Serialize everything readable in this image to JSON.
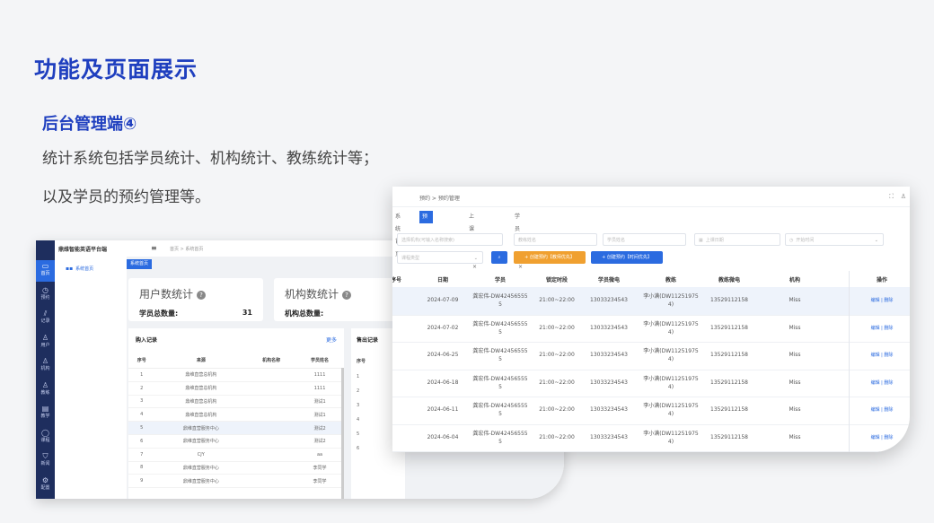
{
  "slide": {
    "title": "功能及页面展示",
    "section": "后台管理端④",
    "desc_line1": "统计系统包括学员统计、机构统计、教练统计等；",
    "desc_line2": "以及学员的预约管理等。"
  },
  "back_window": {
    "brand": "鼎维智能英语平台端",
    "breadcrumb": "首页  >  系统首页",
    "nav_home": "系统首页",
    "page_tab": "系统首页",
    "sidebar": [
      {
        "icon": "monitor-icon",
        "glyph": "▭",
        "label": "首页"
      },
      {
        "icon": "clock-icon",
        "glyph": "◷",
        "label": "预约"
      },
      {
        "icon": "chart-icon",
        "glyph": "⫽",
        "label": "记录"
      },
      {
        "icon": "user-icon",
        "glyph": "♙",
        "label": "用户"
      },
      {
        "icon": "org-icon",
        "glyph": "♙",
        "label": "机构"
      },
      {
        "icon": "coach-icon",
        "glyph": "♙",
        "label": "教练"
      },
      {
        "icon": "doc-icon",
        "glyph": "▤",
        "label": "教学"
      },
      {
        "icon": "course-icon",
        "glyph": "◯",
        "label": "课程"
      },
      {
        "icon": "shield-icon",
        "glyph": "⛉",
        "label": "新闻"
      },
      {
        "icon": "gear-icon",
        "glyph": "⚙",
        "label": "配置"
      }
    ],
    "user_stats": {
      "title": "用户数统计",
      "label": "学员总数量:",
      "value": "31"
    },
    "org_stats": {
      "title": "机构数统计",
      "label": "机构总数量:"
    },
    "purchase": {
      "title": "购入记录",
      "more": "更多",
      "columns": [
        "序号",
        "来源",
        "机构名称",
        "学员姓名"
      ],
      "rows": [
        [
          "1",
          "鼎维直营总机构",
          "",
          "1111"
        ],
        [
          "2",
          "鼎维直营总机构",
          "",
          "1111"
        ],
        [
          "3",
          "鼎维直营总机构",
          "",
          "测试1"
        ],
        [
          "4",
          "鼎维直营总机构",
          "",
          "测试1"
        ],
        [
          "5",
          "鼎维直营服务中心",
          "",
          "测试2"
        ],
        [
          "6",
          "鼎维直营服务中心",
          "",
          "测试2"
        ],
        [
          "7",
          "CJY",
          "",
          "aa"
        ],
        [
          "8",
          "鼎维直营服务中心",
          "",
          "李同学"
        ],
        [
          "9",
          "鼎维直营服务中心",
          "",
          "李同学"
        ]
      ]
    },
    "sales": {
      "title": "售出记录",
      "column": "序号",
      "rows": [
        "1",
        "2",
        "3",
        "4",
        "5",
        "6"
      ]
    }
  },
  "front_window": {
    "breadcrumb": "预约  >  预约管理",
    "tabs": [
      "系统首页",
      "预约管理",
      "上课记录",
      "学员管理"
    ],
    "filters": {
      "org": "选择机构(可输入名称搜索)",
      "coach_name": "教练姓名",
      "student_name": "学员姓名",
      "date": "上课日期",
      "time": "开始时间",
      "course_type": "课程类型"
    },
    "buttons": {
      "search": "⌕",
      "create_teacher": "+  创建预约【教师优先】",
      "create_time": "+  创建预约【时间优先】"
    },
    "columns": [
      "序号",
      "日期",
      "学员",
      "锁定时段",
      "学员微电",
      "教练",
      "教练微电",
      "机构",
      "操作"
    ],
    "rows": [
      {
        "date": "2024-07-09",
        "student": [
          "龚宏伟-DW42456555",
          "5"
        ],
        "slot": "21:00~22:00",
        "phone": "13033234543",
        "coach": [
          "李小满(DW11251975",
          "4)"
        ],
        "coach_phone": "13529112158",
        "org": "Miss",
        "ops": "编辑 | 删除"
      },
      {
        "date": "2024-07-02",
        "student": [
          "龚宏伟-DW42456555",
          "5"
        ],
        "slot": "21:00~22:00",
        "phone": "13033234543",
        "coach": [
          "李小满(DW11251975",
          "4)"
        ],
        "coach_phone": "13529112158",
        "org": "Miss",
        "ops": "编辑 | 删除"
      },
      {
        "date": "2024-06-25",
        "student": [
          "龚宏伟-DW42456555",
          "5"
        ],
        "slot": "21:00~22:00",
        "phone": "13033234543",
        "coach": [
          "李小满(DW11251975",
          "4)"
        ],
        "coach_phone": "13529112158",
        "org": "Miss",
        "ops": "编辑 | 删除"
      },
      {
        "date": "2024-06-18",
        "student": [
          "龚宏伟-DW42456555",
          "5"
        ],
        "slot": "21:00~22:00",
        "phone": "13033234543",
        "coach": [
          "李小满(DW11251975",
          "4)"
        ],
        "coach_phone": "13529112158",
        "org": "Miss",
        "ops": "编辑 | 删除"
      },
      {
        "date": "2024-06-11",
        "student": [
          "龚宏伟-DW42456555",
          "5"
        ],
        "slot": "21:00~22:00",
        "phone": "13033234543",
        "coach": [
          "李小满(DW11251975",
          "4)"
        ],
        "coach_phone": "13529112158",
        "org": "Miss",
        "ops": "编辑 | 删除"
      },
      {
        "date": "2024-06-04",
        "student": [
          "龚宏伟-DW42456555",
          "5"
        ],
        "slot": "21:00~22:00",
        "phone": "13033234543",
        "coach": [
          "李小满(DW11251975",
          "4)"
        ],
        "coach_phone": "13529112158",
        "org": "Miss",
        "ops": "编辑 | 删除"
      }
    ]
  },
  "colors": {
    "title_blue": "#1f3fbf",
    "primary": "#2b6be0",
    "warning": "#f0a030",
    "sidebar": "#1e2e5e"
  }
}
